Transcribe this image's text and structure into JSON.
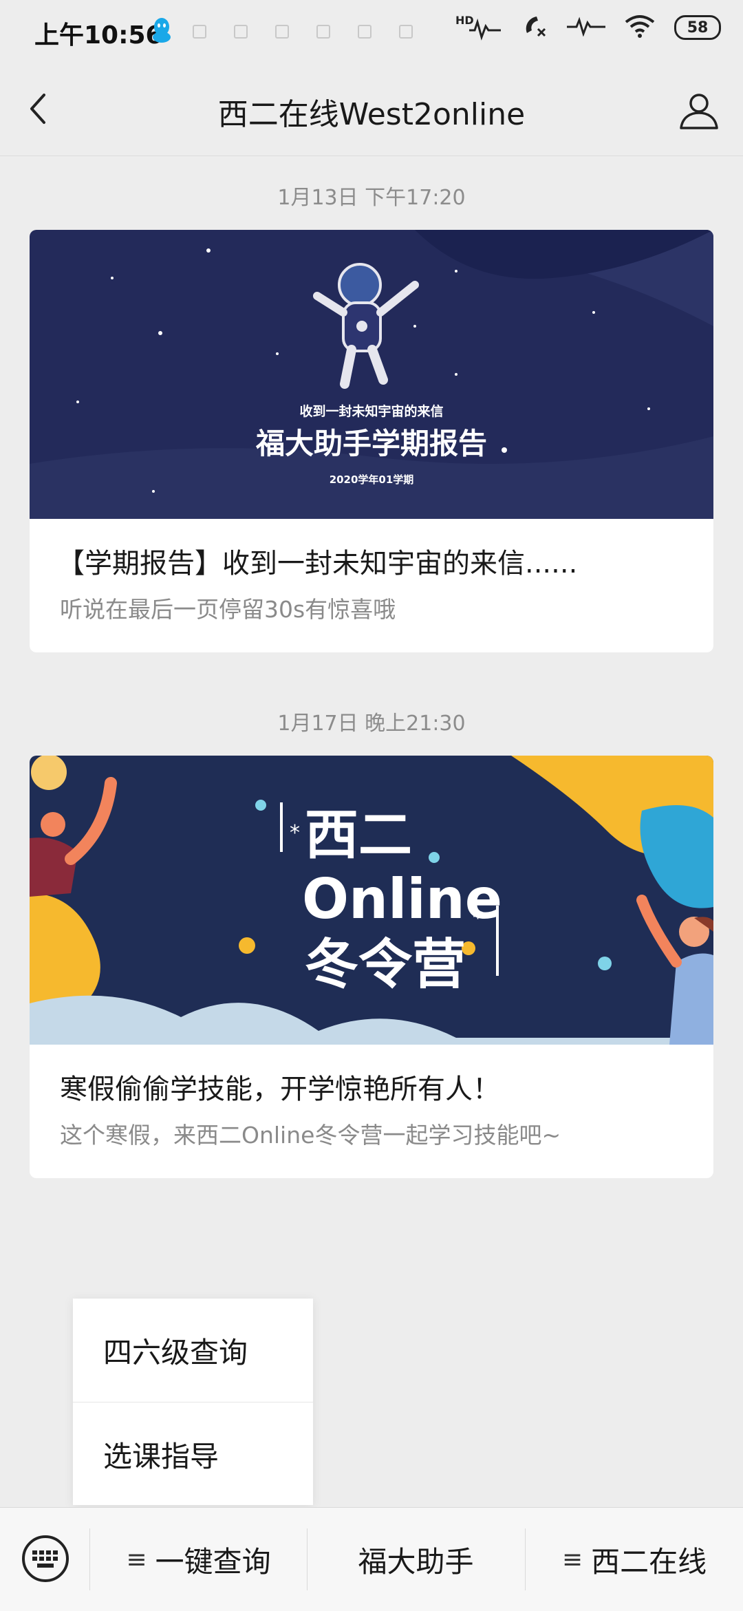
{
  "status_bar": {
    "time": "上午10:56",
    "hd_label": "HD",
    "battery": "58",
    "icons": [
      "qq-icon",
      "hd-signal-icon",
      "call-muted-icon",
      "signal-icon",
      "wifi-icon",
      "battery-icon"
    ]
  },
  "header": {
    "title": "西二在线West2online",
    "back_icon": "chevron-left-icon",
    "profile_icon": "person-icon"
  },
  "messages": [
    {
      "timestamp": "1月13日 下午17:20",
      "cover": {
        "line1": "收到一封未知宇宙的来信",
        "line2": "福大助手学期报告",
        "line3": "2020学年01学期",
        "bg_color": "#232a5a"
      },
      "title": "【学期报告】收到一封未知宇宙的来信......",
      "desc": "听说在最后一页停留30s有惊喜哦"
    },
    {
      "timestamp": "1月17日 晚上21:30",
      "cover": {
        "line1": "西二",
        "line2": "Online",
        "line3": "冬令营",
        "bg_color": "#1f2d55"
      },
      "title": "寒假偷偷学技能，开学惊艳所有人！",
      "desc": "这个寒假，来西二Online冬令营一起学习技能吧~"
    }
  ],
  "popup_menu": {
    "items": [
      "四六级查询",
      "选课指导"
    ]
  },
  "bottom_menu": {
    "keyboard_icon": "keyboard-icon",
    "items": [
      {
        "label": "一键查询",
        "has_submenu": true
      },
      {
        "label": "福大助手",
        "has_submenu": false
      },
      {
        "label": "西二在线",
        "has_submenu": true
      }
    ],
    "submenu_icon": "≡"
  }
}
